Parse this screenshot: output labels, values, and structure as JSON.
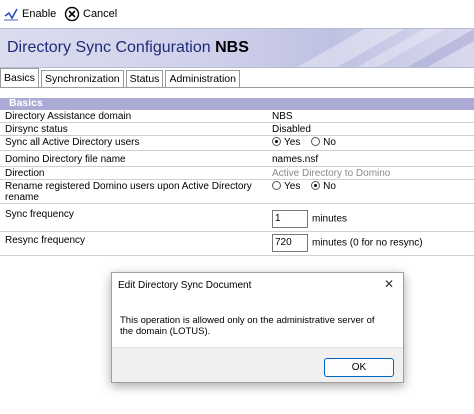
{
  "toolbar": {
    "enable_label": "Enable",
    "cancel_label": "Cancel"
  },
  "header": {
    "title_prefix": "Directory Sync Configuration",
    "title_name": "NBS"
  },
  "tabs": [
    {
      "label": "Basics",
      "active": true
    },
    {
      "label": "Synchronization",
      "active": false
    },
    {
      "label": "Status",
      "active": false
    },
    {
      "label": "Administration",
      "active": false
    }
  ],
  "section": {
    "title": "Basics"
  },
  "fields": {
    "domain": {
      "label": "Directory Assistance domain",
      "value": "NBS"
    },
    "dirsync_status": {
      "label": "Dirsync status",
      "value": "Disabled"
    },
    "sync_all": {
      "label": "Sync all Active Directory users",
      "yes": "Yes",
      "no": "No",
      "selected": "Yes"
    },
    "domino_dir": {
      "label": "Domino Directory file name",
      "value": "names.nsf"
    },
    "direction": {
      "label": "Direction",
      "value": "Active Directory to Domino"
    },
    "rename": {
      "label": "Rename registered Domino users upon Active Directory rename",
      "yes": "Yes",
      "no": "No",
      "selected": "No"
    },
    "sync_freq": {
      "label": "Sync frequency",
      "value": "1",
      "unit": "minutes"
    },
    "resync_freq": {
      "label": "Resync frequency",
      "value": "720",
      "unit": "minutes (0 for no resync)"
    }
  },
  "dialog": {
    "title": "Edit Directory Sync Document",
    "message": "This operation is allowed only on the administrative server of the domain (LOTUS).",
    "ok_label": "OK",
    "close_icon": "close-icon"
  },
  "colors": {
    "section_bg": "#a9abd4",
    "title_blue": "#1f2a7a",
    "ok_border": "#0067c0"
  }
}
